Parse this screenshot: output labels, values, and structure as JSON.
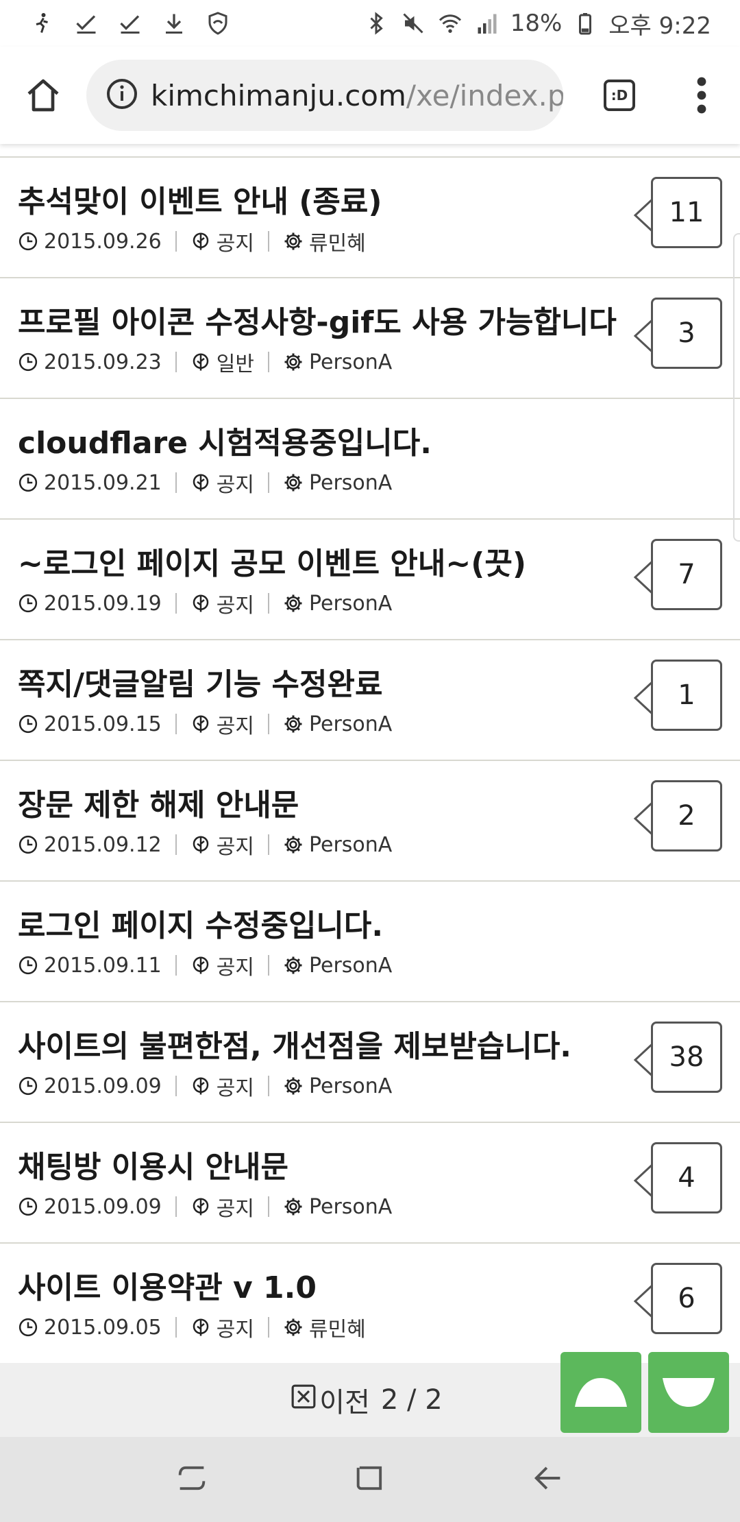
{
  "status_bar": {
    "battery": "18%",
    "time": "오후 9:22",
    "icons": [
      "runner-icon",
      "check-icon",
      "check-icon",
      "download-icon",
      "shield-icon",
      "bluetooth-icon",
      "mute-icon",
      "wifi-icon",
      "signal-icon",
      "battery-icon"
    ]
  },
  "browser": {
    "url_host": "kimchimanju.com",
    "url_path": "/xe/index.p",
    "tab_label": ":D"
  },
  "posts": [
    {
      "title": "추석맞이 이벤트 안내 (종료)",
      "date": "2015.09.26",
      "category": "공지",
      "author": "류민혜",
      "comments": "11"
    },
    {
      "title": "프로필 아이콘 수정사항-gif도 사용 가능합니다",
      "date": "2015.09.23",
      "category": "일반",
      "author": "PersonA",
      "comments": "3"
    },
    {
      "title": "cloudflare 시험적용중입니다.",
      "date": "2015.09.21",
      "category": "공지",
      "author": "PersonA",
      "comments": ""
    },
    {
      "title": "~로그인 페이지 공모 이벤트 안내~(끗)",
      "date": "2015.09.19",
      "category": "공지",
      "author": "PersonA",
      "comments": "7"
    },
    {
      "title": "쪽지/댓글알림 기능 수정완료",
      "date": "2015.09.15",
      "category": "공지",
      "author": "PersonA",
      "comments": "1"
    },
    {
      "title": "장문 제한 해제 안내문",
      "date": "2015.09.12",
      "category": "공지",
      "author": "PersonA",
      "comments": "2"
    },
    {
      "title": "로그인 페이지 수정중입니다.",
      "date": "2015.09.11",
      "category": "공지",
      "author": "PersonA",
      "comments": ""
    },
    {
      "title": "사이트의 불편한점, 개선점을 제보받습니다.",
      "date": "2015.09.09",
      "category": "공지",
      "author": "PersonA",
      "comments": "38"
    },
    {
      "title": "채팅방 이용시 안내문",
      "date": "2015.09.09",
      "category": "공지",
      "author": "PersonA",
      "comments": "4"
    },
    {
      "title": "사이트 이용약관 v 1.0",
      "date": "2015.09.05",
      "category": "공지",
      "author": "류민혜",
      "comments": "6"
    }
  ],
  "pager": {
    "prev_label": "이전",
    "page": "2 / 2"
  },
  "colors": {
    "scroll_button": "#5cb85c",
    "divider": "#d8d8d0"
  }
}
